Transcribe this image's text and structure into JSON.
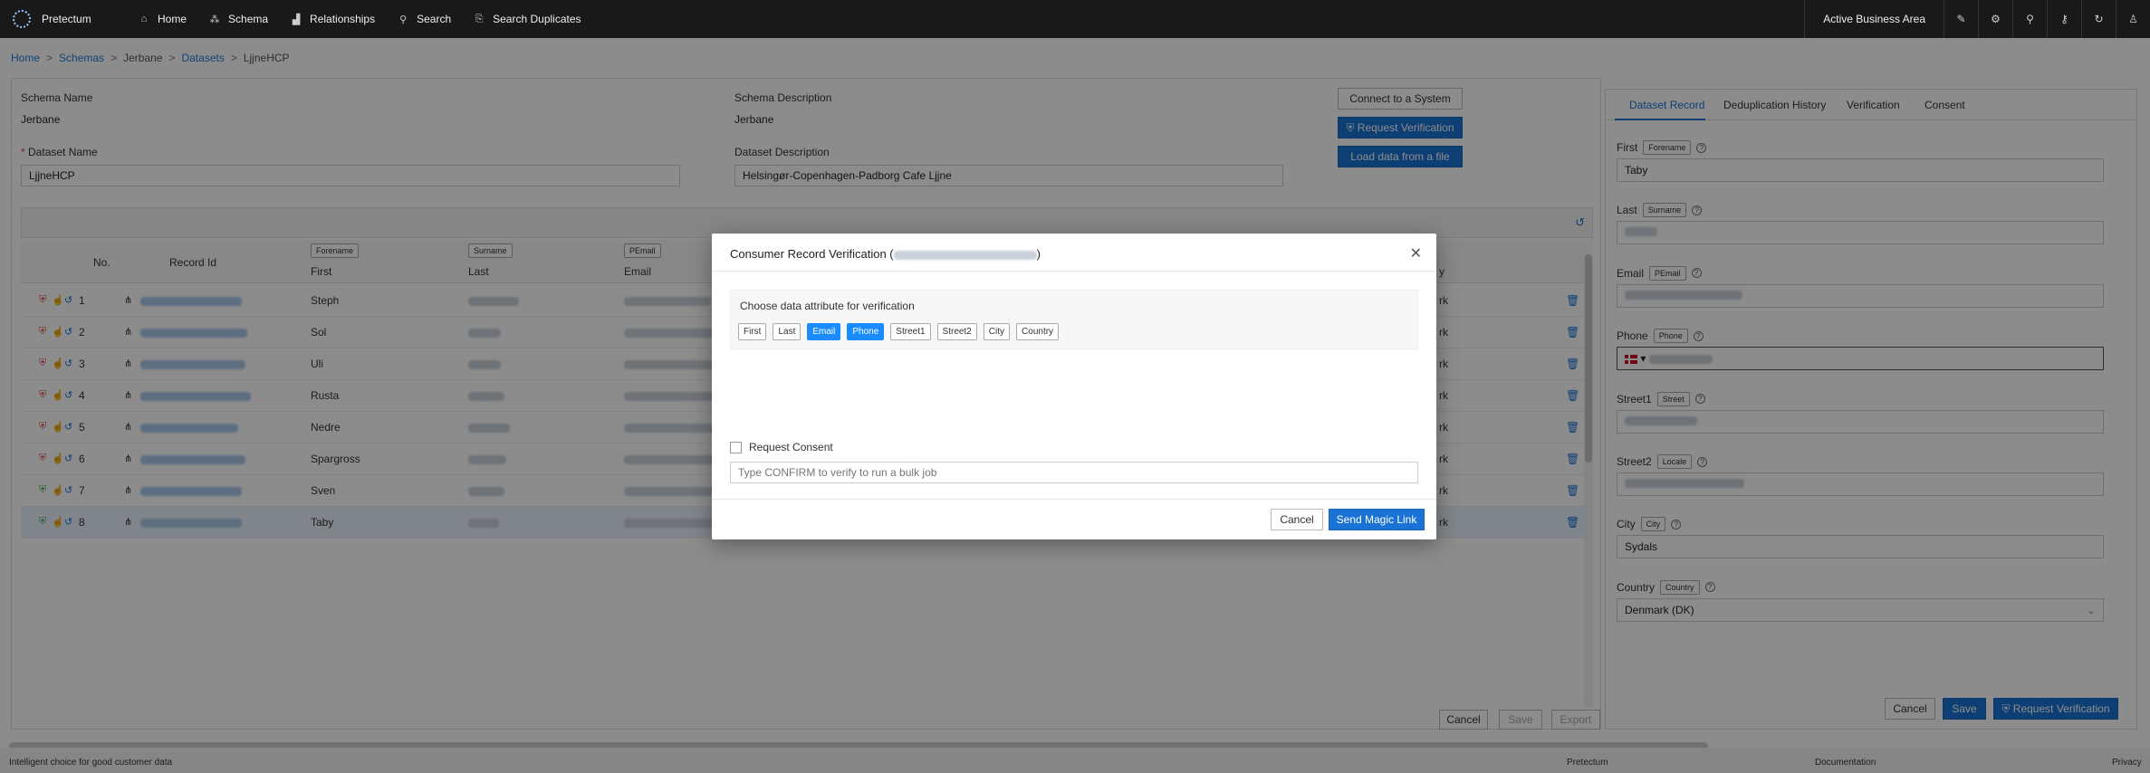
{
  "nav": {
    "brand": "Pretectum",
    "items": [
      {
        "label": "Home",
        "icon": "home-icon"
      },
      {
        "label": "Schema",
        "icon": "schema-icon"
      },
      {
        "label": "Relationships",
        "icon": "relationships-icon"
      },
      {
        "label": "Search",
        "icon": "search-icon"
      },
      {
        "label": "Search Duplicates",
        "icon": "search-duplicates-icon"
      }
    ],
    "active_area": "Active Business Area"
  },
  "breadcrumb": {
    "home": "Home",
    "schemas": "Schemas",
    "schema": "Jerbane",
    "datasets": "Datasets",
    "current": "LjjneHCP"
  },
  "form": {
    "schema_name_label": "Schema Name",
    "schema_name": "Jerbane",
    "schema_desc_label": "Schema Description",
    "schema_desc": "Jerbane",
    "dataset_name_label": "Dataset Name",
    "required_mark": "*",
    "dataset_name": "LjjneHCP",
    "dataset_desc_label": "Dataset Description",
    "dataset_desc": "Helsingør-Copenhagen-Padborg Cafe Ljjne",
    "connect_btn": "Connect to a System",
    "request_verif_btn": "Request Verification",
    "load_btn": "Load data from a file"
  },
  "grid": {
    "col_no": "No.",
    "col_record": "Record Id",
    "col_first_tag": "Forename",
    "col_first": "First",
    "col_last_tag": "Surname",
    "col_last": "Last",
    "col_email_tag": "PEmail",
    "col_email": "Email",
    "col_country_partial": "y",
    "rows": [
      {
        "no": "1",
        "first": "Steph",
        "country": "rk"
      },
      {
        "no": "2",
        "first": "Sol",
        "country": "rk"
      },
      {
        "no": "3",
        "first": "Uli",
        "country": "rk"
      },
      {
        "no": "4",
        "first": "Rusta",
        "country": "rk"
      },
      {
        "no": "5",
        "first": "Nedre",
        "country": "rk"
      },
      {
        "no": "6",
        "first": "Spargross",
        "country": "rk"
      },
      {
        "no": "7",
        "first": "Sven",
        "country": "rk"
      },
      {
        "no": "8",
        "first": "Taby",
        "country": "rk"
      }
    ],
    "cancel": "Cancel",
    "save": "Save",
    "export": "Export"
  },
  "right": {
    "tabs": [
      "Dataset Record",
      "Deduplication History",
      "Verification",
      "Consent"
    ],
    "fields": [
      {
        "label": "First",
        "tag": "Forename",
        "value": "Taby"
      },
      {
        "label": "Last",
        "tag": "Surname",
        "value": ""
      },
      {
        "label": "Email",
        "tag": "PEmail",
        "value": ""
      },
      {
        "label": "Phone",
        "tag": "Phone",
        "value": ""
      },
      {
        "label": "Street1",
        "tag": "Street",
        "value": ""
      },
      {
        "label": "Street2",
        "tag": "Locale",
        "value": ""
      },
      {
        "label": "City",
        "tag": "City",
        "value": "Sydals"
      },
      {
        "label": "Country",
        "tag": "Country",
        "value": "Denmark (DK)"
      }
    ],
    "cancel": "Cancel",
    "save": "Save",
    "request_verif": "Request Verification"
  },
  "modal": {
    "title": "Consumer Record Verification (",
    "title_end": ")",
    "attr_title": "Choose data attribute for verification",
    "chips": [
      {
        "label": "First",
        "on": false
      },
      {
        "label": "Last",
        "on": false
      },
      {
        "label": "Email",
        "on": true
      },
      {
        "label": "Phone",
        "on": true
      },
      {
        "label": "Street1",
        "on": false
      },
      {
        "label": "Street2",
        "on": false
      },
      {
        "label": "City",
        "on": false
      },
      {
        "label": "Country",
        "on": false
      }
    ],
    "consent_label": "Request Consent",
    "confirm_placeholder": "Type CONFIRM to verify to run a bulk job",
    "cancel": "Cancel",
    "send": "Send Magic Link"
  },
  "footer": {
    "tagline": "Intelligent choice for good customer data",
    "pretectum": "Pretectum",
    "documentation": "Documentation",
    "privacy": "Privacy"
  },
  "colors": {
    "accent": "#1a73d4",
    "chip_on": "#1a8cff",
    "nav_bg": "#191919"
  }
}
